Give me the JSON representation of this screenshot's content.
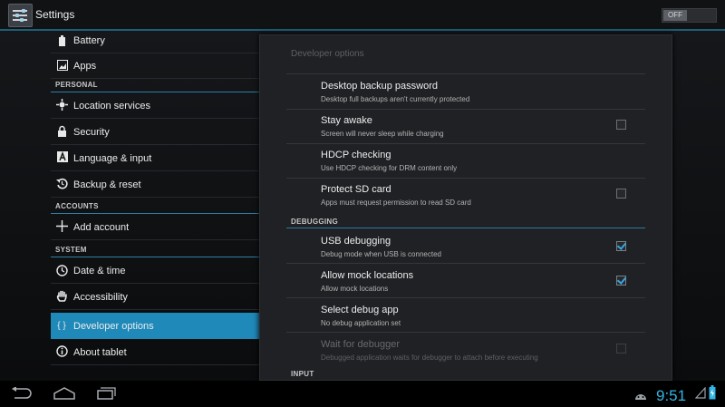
{
  "action_bar": {
    "title": "Settings",
    "toggle_label": "OFF"
  },
  "headers": {
    "battery": "Battery",
    "apps": "Apps",
    "personal": "PERSONAL",
    "location": "Location services",
    "security": "Security",
    "language": "Language & input",
    "backup": "Backup & reset",
    "accounts": "ACCOUNTS",
    "add_account": "Add account",
    "system": "SYSTEM",
    "datetime": "Date & time",
    "accessibility": "Accessibility",
    "developer": "Developer options",
    "developer_icon": "{ }",
    "about": "About tablet"
  },
  "developer": {
    "title": "Developer options",
    "prefs": [
      {
        "title": "Desktop backup password",
        "summary": "Desktop full backups aren't currently protected"
      },
      {
        "title": "Stay awake",
        "summary": "Screen will never sleep while charging"
      },
      {
        "title": "HDCP checking",
        "summary": "Use HDCP checking for DRM content only"
      },
      {
        "title": "Protect SD card",
        "summary": "Apps must request permission to read SD card"
      }
    ],
    "debugging_label": "DEBUGGING",
    "debug_prefs": [
      {
        "title": "USB debugging",
        "summary": "Debug mode when USB is connected"
      },
      {
        "title": "Allow mock locations",
        "summary": "Allow mock locations"
      },
      {
        "title": "Select debug app",
        "summary": "No debug application set"
      },
      {
        "title": "Wait for debugger",
        "summary": "Debugged application waits for debugger to attach before executing"
      }
    ],
    "input_label": "INPUT"
  },
  "checkbox_states": {
    "stay_awake": false,
    "protect_sd": false,
    "usb_debugging": true,
    "mock_locations": true,
    "wait_for_debugger": false
  },
  "status": {
    "time": "9:51"
  },
  "colors": {
    "accent": "#33b5e5",
    "selected": "#1f89b9"
  }
}
